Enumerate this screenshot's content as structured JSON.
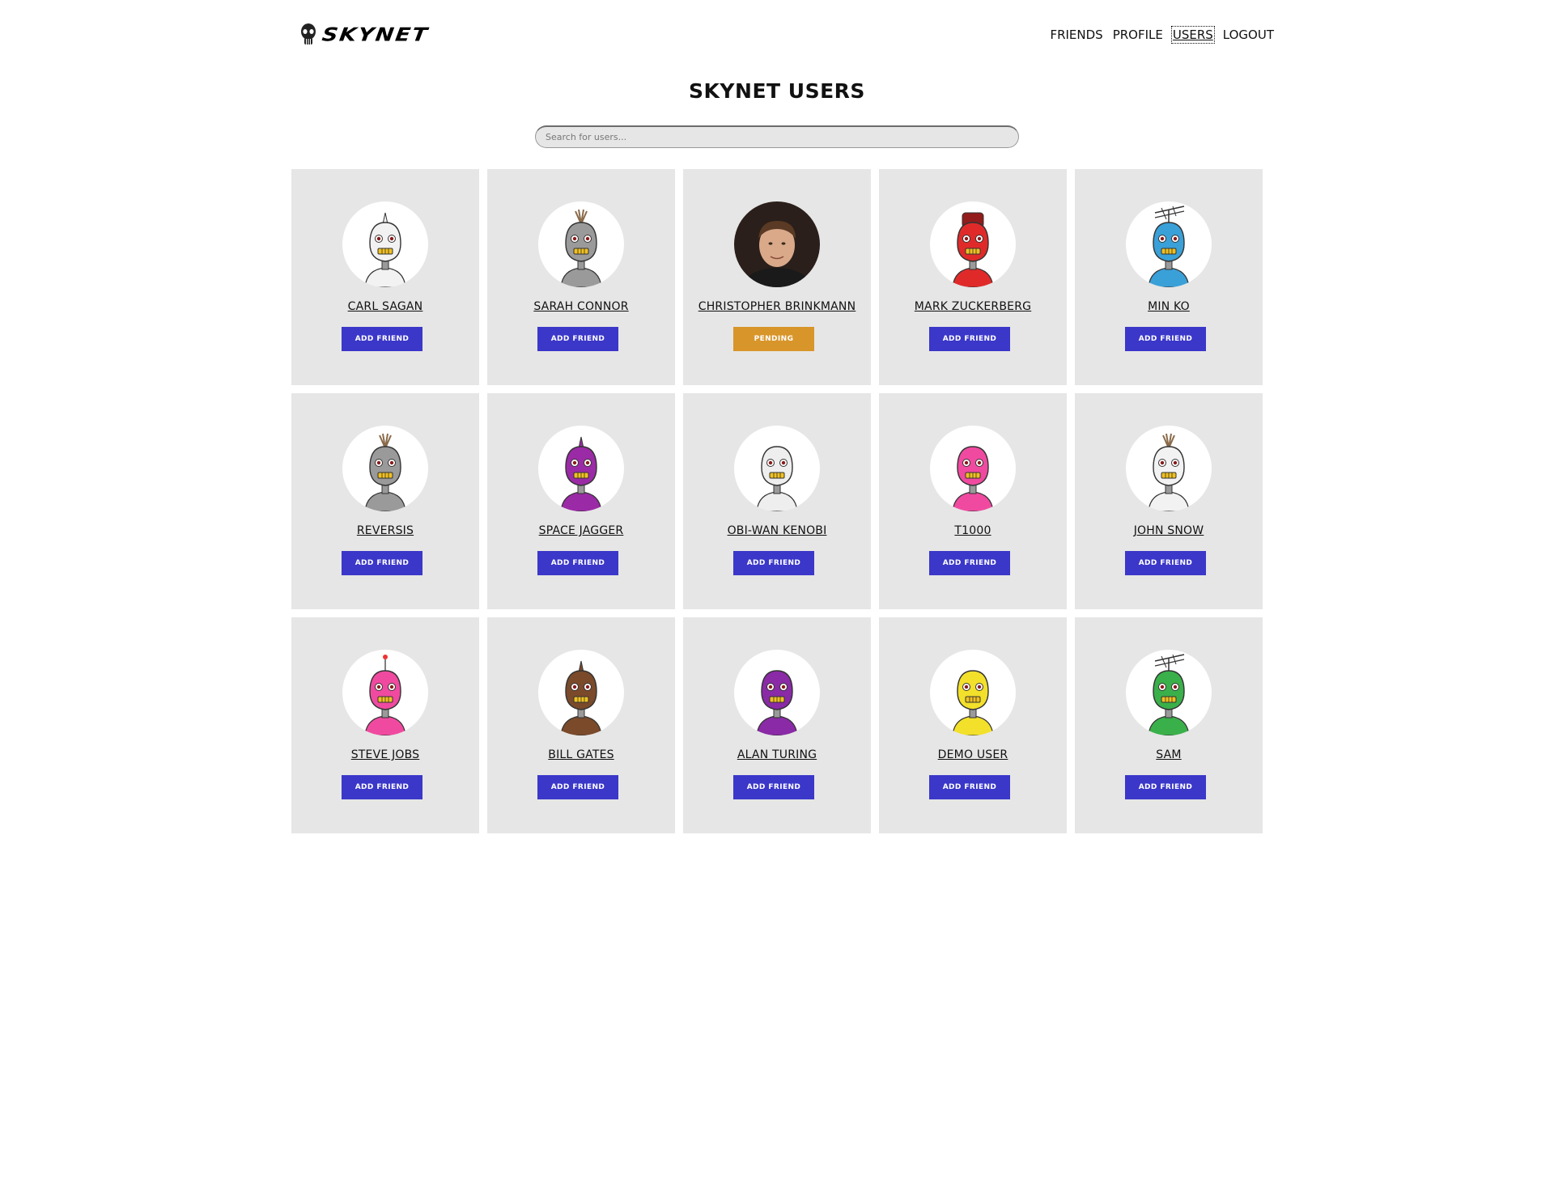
{
  "brand": {
    "name": "SKYNET"
  },
  "nav": [
    {
      "label": "FRIENDS",
      "active": false
    },
    {
      "label": "PROFILE",
      "active": false
    },
    {
      "label": "USERS",
      "active": true
    },
    {
      "label": "LOGOUT",
      "active": false
    }
  ],
  "page": {
    "title": "SKYNET USERS"
  },
  "search": {
    "placeholder": "Search for users..."
  },
  "colors": {
    "accent": "#3b37c9",
    "pending": "#d8952a",
    "card_bg": "#e6e6e6"
  },
  "users": [
    {
      "name": "CARL SAGAN",
      "action": "ADD FRIEND",
      "status": "add",
      "avatar": "robot",
      "color": "#f2f2f2",
      "topper": "spike"
    },
    {
      "name": "SARAH CONNOR",
      "action": "ADD FRIEND",
      "status": "add",
      "avatar": "robot",
      "color": "#9a9a9a",
      "topper": "tuft"
    },
    {
      "name": "CHRISTOPHER BRINKMANN",
      "action": "PENDING",
      "status": "pending",
      "avatar": "photo",
      "color": "#3a2a22",
      "topper": "none"
    },
    {
      "name": "MARK ZUCKERBERG",
      "action": "ADD FRIEND",
      "status": "add",
      "avatar": "robot",
      "color": "#e02a2a",
      "topper": "cap"
    },
    {
      "name": "MIN KO",
      "action": "ADD FRIEND",
      "status": "add",
      "avatar": "robot",
      "color": "#3aa0d8",
      "topper": "antenna"
    },
    {
      "name": "REVERSIS",
      "action": "ADD FRIEND",
      "status": "add",
      "avatar": "robot",
      "color": "#9a9a9a",
      "topper": "tuft"
    },
    {
      "name": "SPACE JAGGER",
      "action": "ADD FRIEND",
      "status": "add",
      "avatar": "robot",
      "color": "#9b2aa6",
      "topper": "spike"
    },
    {
      "name": "OBI-WAN KENOBI",
      "action": "ADD FRIEND",
      "status": "add",
      "avatar": "robot",
      "color": "#eeeeee",
      "topper": "none"
    },
    {
      "name": "T1000",
      "action": "ADD FRIEND",
      "status": "add",
      "avatar": "robot",
      "color": "#f04aa0",
      "topper": "none"
    },
    {
      "name": "JOHN SNOW",
      "action": "ADD FRIEND",
      "status": "add",
      "avatar": "robot",
      "color": "#f2f2f2",
      "topper": "tuft"
    },
    {
      "name": "STEVE JOBS",
      "action": "ADD FRIEND",
      "status": "add",
      "avatar": "robot",
      "color": "#f04aa0",
      "topper": "ball"
    },
    {
      "name": "BILL GATES",
      "action": "ADD FRIEND",
      "status": "add",
      "avatar": "robot",
      "color": "#7a4a2a",
      "topper": "spike"
    },
    {
      "name": "ALAN TURING",
      "action": "ADD FRIEND",
      "status": "add",
      "avatar": "robot",
      "color": "#8a2aa6",
      "topper": "none"
    },
    {
      "name": "DEMO USER",
      "action": "ADD FRIEND",
      "status": "add",
      "avatar": "robot",
      "color": "#f2e02a",
      "topper": "none"
    },
    {
      "name": "SAM",
      "action": "ADD FRIEND",
      "status": "add",
      "avatar": "robot",
      "color": "#3ab04a",
      "topper": "antenna"
    }
  ]
}
